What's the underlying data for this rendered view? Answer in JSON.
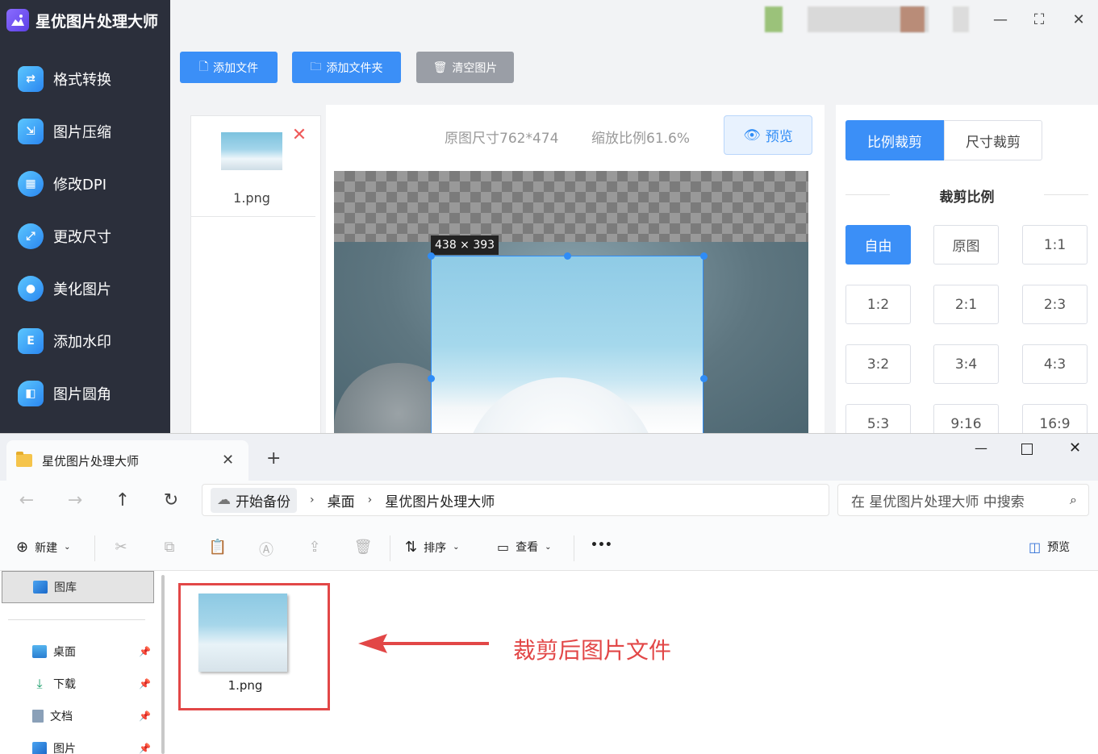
{
  "app": {
    "title": "星优图片处理大师",
    "sidebar": [
      {
        "label": "格式转换",
        "icon": "image-convert-icon"
      },
      {
        "label": "图片压缩",
        "icon": "image-compress-icon"
      },
      {
        "label": "修改DPI",
        "icon": "dpi-icon"
      },
      {
        "label": "更改尺寸",
        "icon": "resize-icon"
      },
      {
        "label": "美化图片",
        "icon": "beautify-icon"
      },
      {
        "label": "添加水印",
        "icon": "watermark-icon"
      },
      {
        "label": "图片圆角",
        "icon": "rounded-corner-icon"
      }
    ],
    "toolbar": {
      "add_file": "添加文件",
      "add_folder": "添加文件夹",
      "clear": "清空图片"
    },
    "file_list": [
      {
        "name": "1.png"
      }
    ],
    "editor": {
      "original_size": "原图尺寸762*474",
      "zoom": "缩放比例61.6%",
      "preview": "预览",
      "crop_size": "438 × 393"
    },
    "crop_panel": {
      "tabs": [
        "比例裁剪",
        "尺寸裁剪"
      ],
      "active_tab": "比例裁剪",
      "section_title": "裁剪比例",
      "ratios": [
        "自由",
        "原图",
        "1:1",
        "1:2",
        "2:1",
        "2:3",
        "3:2",
        "3:4",
        "4:3",
        "5:3",
        "9:16",
        "16:9"
      ],
      "active_ratio": "自由"
    },
    "colors": {
      "accent": "#3b8ff7",
      "sidebar_bg": "#2b2f3b",
      "clear_btn": "#9a9ea6",
      "annotation": "#e24747"
    }
  },
  "explorer": {
    "tab_title": "星优图片处理大师",
    "breadcrumb": [
      "开始备份",
      "桌面",
      "星优图片处理大师"
    ],
    "search_placeholder": "在 星优图片处理大师 中搜索",
    "commands": {
      "new": "新建",
      "sort": "排序",
      "view": "查看",
      "more": "•••",
      "preview": "预览"
    },
    "nav": {
      "selected": "图库",
      "quick_access": [
        "桌面",
        "下载",
        "文档",
        "图片"
      ]
    },
    "files": [
      {
        "name": "1.png"
      }
    ]
  },
  "annotation": "裁剪后图片文件"
}
